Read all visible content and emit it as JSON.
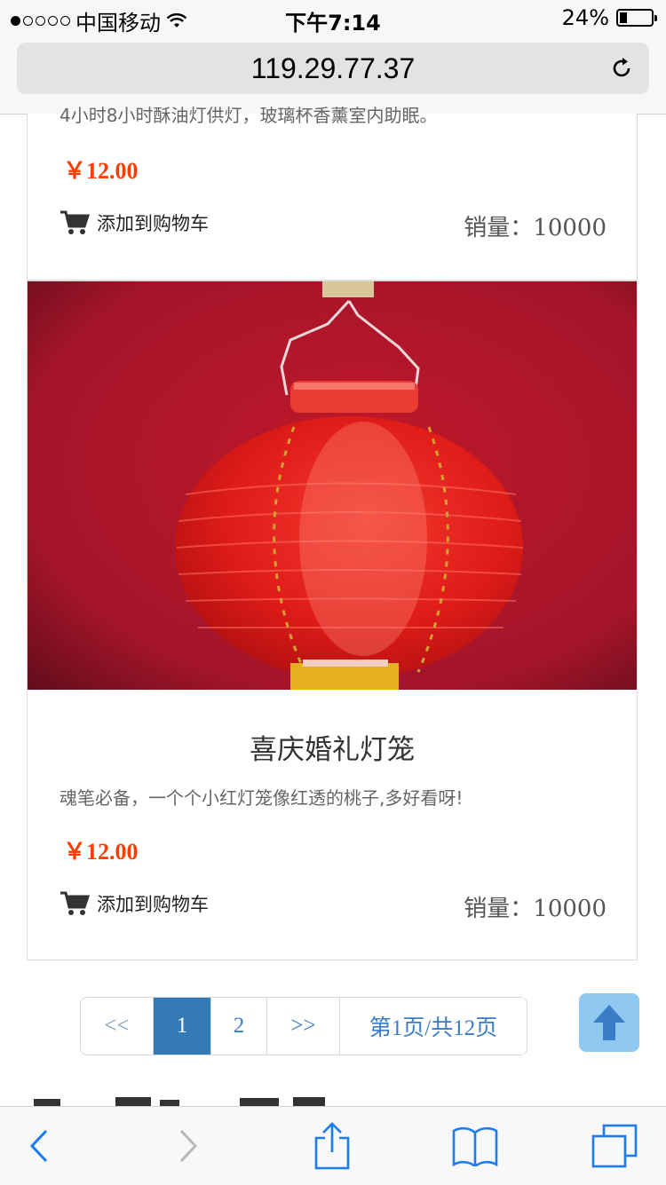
{
  "status_bar": {
    "carrier": "中国移动",
    "time": "下午7:14",
    "battery": "24%"
  },
  "browser": {
    "url": "119.29.77.37"
  },
  "products": [
    {
      "desc_cut": "4小时8小时酥油灯供灯，玻璃杯香薰室内助眠。",
      "price": "￥12.00",
      "cart_label": "添加到购物车",
      "sales": "销量：10000"
    },
    {
      "title": "喜庆婚礼灯笼",
      "desc": "魂笔必备，一个个小红灯笼像红透的桃子,多好看呀!",
      "price": "￥12.00",
      "cart_label": "添加到购物车",
      "sales": "销量：10000"
    }
  ],
  "pagination": {
    "prev": "<<",
    "pages": [
      "1",
      "2"
    ],
    "active": "1",
    "next": ">>",
    "summary": "第1页/共12页"
  },
  "colors": {
    "price": "#ff3d00",
    "active_page": "#337ab7",
    "link": "#3a7cc6",
    "ios_blue": "#1a7cf0"
  }
}
